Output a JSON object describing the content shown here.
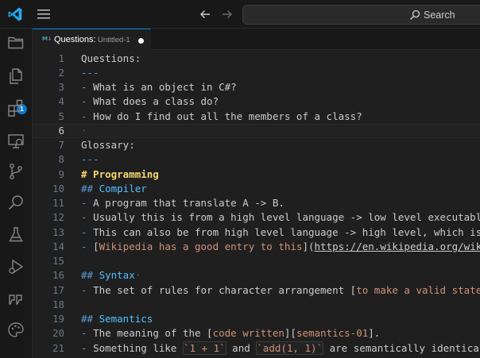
{
  "header": {
    "search_label": "Search"
  },
  "activity": {
    "badge_count": "1"
  },
  "tab": {
    "icon_text": "M↓",
    "title": "Questions:",
    "description": "Untitled-1"
  },
  "editor": {
    "lines": [
      {
        "n": "1",
        "tokens": [
          {
            "t": "Questions:",
            "c": "t-md"
          }
        ]
      },
      {
        "n": "2",
        "tokens": [
          {
            "t": "---",
            "c": "t-punct"
          }
        ]
      },
      {
        "n": "3",
        "tokens": [
          {
            "t": "- ",
            "c": "t-punct"
          },
          {
            "t": "What is an object in C#?",
            "c": "t-md"
          }
        ]
      },
      {
        "n": "4",
        "tokens": [
          {
            "t": "- ",
            "c": "t-punct"
          },
          {
            "t": "What does a class do?",
            "c": "t-md"
          }
        ]
      },
      {
        "n": "5",
        "tokens": [
          {
            "t": "- ",
            "c": "t-punct"
          },
          {
            "t": "How do I find out all the members of a class?",
            "c": "t-md"
          }
        ]
      },
      {
        "n": "6",
        "tokens": [
          {
            "t": "·",
            "c": "t-dim"
          }
        ]
      },
      {
        "n": "7",
        "tokens": [
          {
            "t": "Glossary:",
            "c": "t-md"
          }
        ]
      },
      {
        "n": "8",
        "tokens": [
          {
            "t": "---",
            "c": "t-punct"
          }
        ]
      },
      {
        "n": "9",
        "tokens": [
          {
            "t": "# Programming",
            "c": "t-heading"
          }
        ]
      },
      {
        "n": "10",
        "tokens": [
          {
            "t": "## ",
            "c": "t-punct"
          },
          {
            "t": "Compiler",
            "c": "t-h2"
          }
        ]
      },
      {
        "n": "11",
        "tokens": [
          {
            "t": "- ",
            "c": "t-punct"
          },
          {
            "t": "A program that translate A -> B.",
            "c": "t-md"
          }
        ]
      },
      {
        "n": "12",
        "tokens": [
          {
            "t": "- ",
            "c": "t-punct"
          },
          {
            "t": "Usually this is from a high level language -> low level executable,",
            "c": "t-md"
          }
        ]
      },
      {
        "n": "13",
        "tokens": [
          {
            "t": "- ",
            "c": "t-punct"
          },
          {
            "t": "This can also be from high level language -> high level, which is k",
            "c": "t-md"
          }
        ]
      },
      {
        "n": "14",
        "tokens": [
          {
            "t": "- ",
            "c": "t-punct"
          },
          {
            "t": "[",
            "c": "t-md"
          },
          {
            "t": "Wikipedia has a good entry to this",
            "c": "t-link"
          },
          {
            "t": "](",
            "c": "t-md"
          },
          {
            "t": "https://en.wikipedia.org/wiki/",
            "c": "t-url"
          }
        ]
      },
      {
        "n": "15",
        "tokens": []
      },
      {
        "n": "16",
        "tokens": [
          {
            "t": "## ",
            "c": "t-punct"
          },
          {
            "t": "Syntax",
            "c": "t-h2"
          },
          {
            "t": "·",
            "c": "t-dim"
          }
        ]
      },
      {
        "n": "17",
        "tokens": [
          {
            "t": "- ",
            "c": "t-punct"
          },
          {
            "t": "The set of rules for character arrangement [",
            "c": "t-md"
          },
          {
            "t": "to make a valid stateme",
            "c": "t-link"
          }
        ]
      },
      {
        "n": "18",
        "tokens": []
      },
      {
        "n": "19",
        "tokens": [
          {
            "t": "## ",
            "c": "t-punct"
          },
          {
            "t": "Semantics",
            "c": "t-h2"
          }
        ]
      },
      {
        "n": "20",
        "tokens": [
          {
            "t": "- ",
            "c": "t-punct"
          },
          {
            "t": "The meaning of the [",
            "c": "t-md"
          },
          {
            "t": "code written",
            "c": "t-link"
          },
          {
            "t": "][",
            "c": "t-md"
          },
          {
            "t": "semantics-01",
            "c": "t-link"
          },
          {
            "t": "].",
            "c": "t-md"
          }
        ]
      },
      {
        "n": "21",
        "tokens": [
          {
            "t": "- ",
            "c": "t-punct"
          },
          {
            "t": "Something like ",
            "c": "t-md"
          },
          {
            "t": "`1 + 1`",
            "c": "t-code"
          },
          {
            "t": " and ",
            "c": "t-md"
          },
          {
            "t": "`add(1, 1)`",
            "c": "t-code"
          },
          {
            "t": " are semantically identical.",
            "c": "t-md"
          }
        ]
      }
    ],
    "current_line": "6"
  },
  "colors": {
    "accent": "#0078d4",
    "heading": "#f5d76e",
    "subheading": "#4fc1ff",
    "link_text": "#ce9178"
  }
}
